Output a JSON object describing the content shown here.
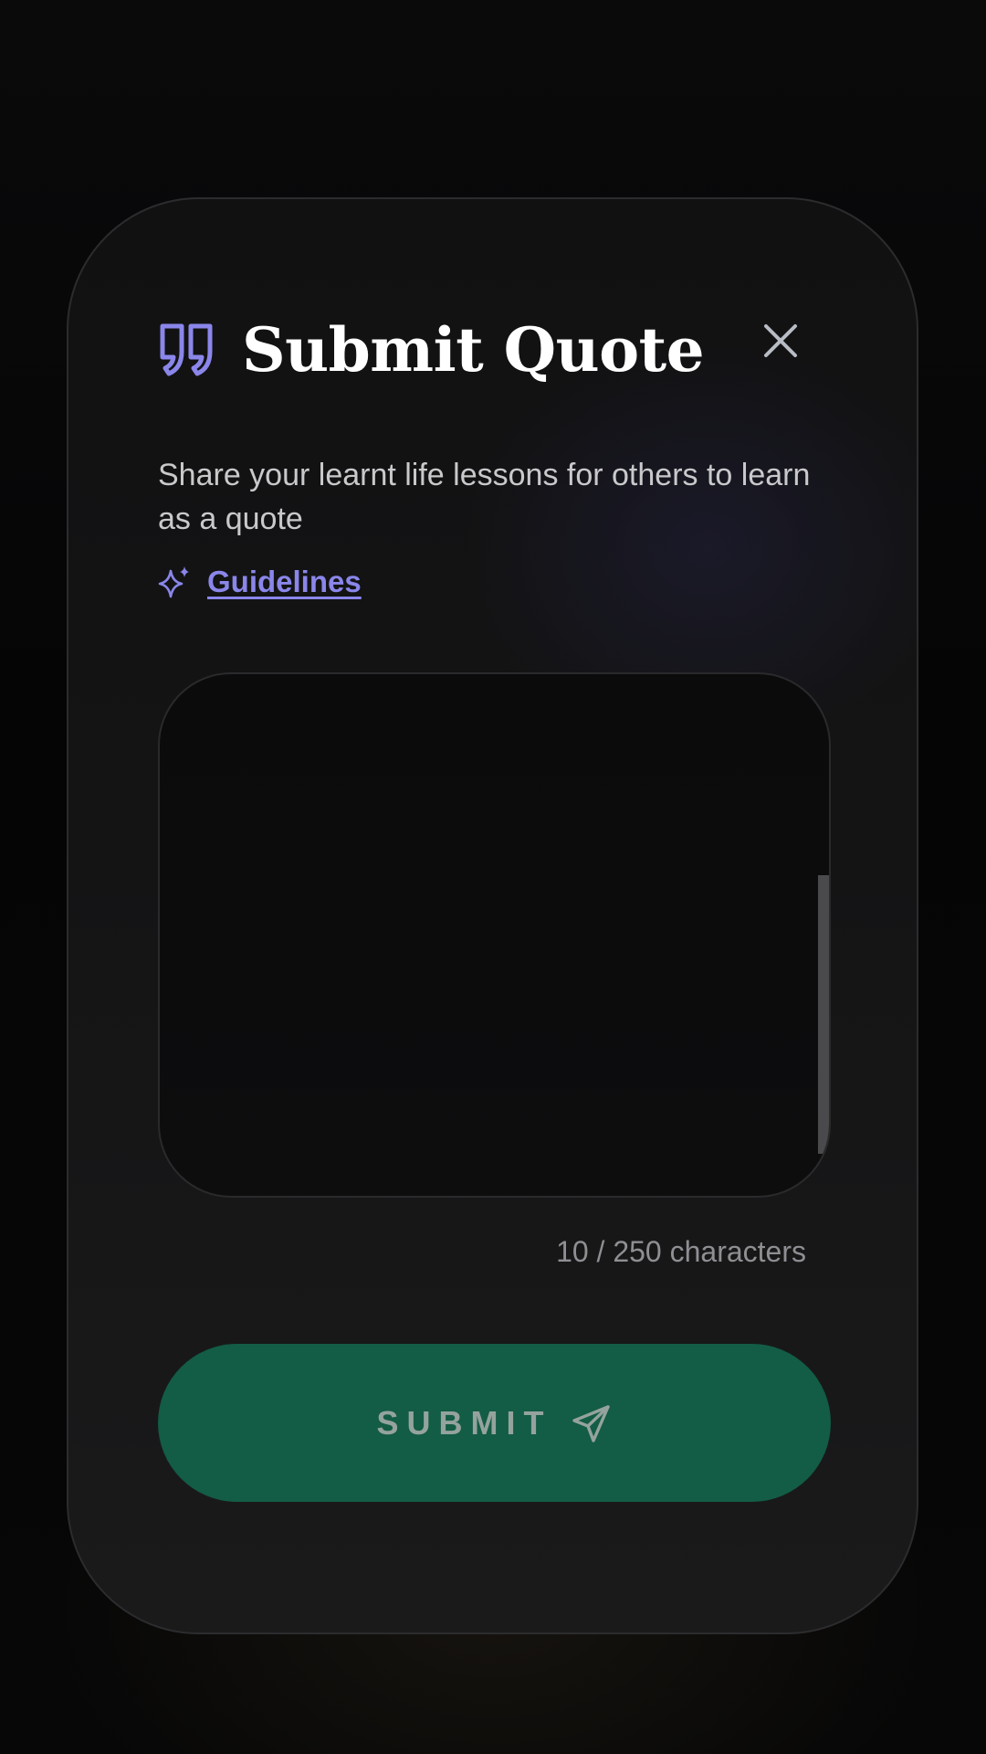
{
  "dialog": {
    "title": "Submit Quote",
    "title_icon": "quote-icon",
    "close_icon": "close-icon",
    "description": "Share your learnt life lessons for others to learn as a quote",
    "guidelines": {
      "icon": "sparkle-icon",
      "label": "Guidelines"
    },
    "quote_input": {
      "value": "",
      "placeholder": ""
    },
    "char_count": "10 / 250 characters",
    "submit": {
      "label": "SUBMIT",
      "icon": "send-icon"
    }
  },
  "colors": {
    "accent": "#8a86ea",
    "submit_bg": "#135c45",
    "submit_text": "#94a39d",
    "title": "#ffffff",
    "description": "#c9c9cc",
    "muted": "#8f8f93"
  }
}
